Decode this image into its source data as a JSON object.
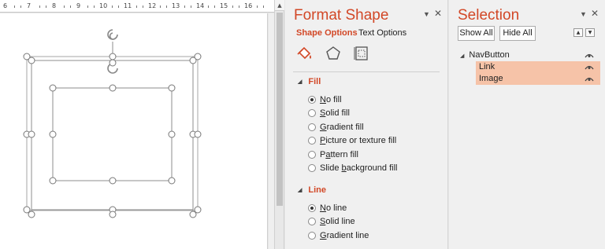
{
  "ruler": {
    "labels": [
      "6",
      "7",
      "8",
      "9",
      "10",
      "11",
      "12",
      "13",
      "14",
      "15",
      "16"
    ]
  },
  "format_shape": {
    "title": "Format Shape",
    "tabs": [
      {
        "label": "Shape Options",
        "active": true
      },
      {
        "label": "Text Options",
        "active": false
      }
    ],
    "icons": [
      "fill-line-icon",
      "effects-pentagon-icon",
      "size-properties-icon"
    ],
    "fill": {
      "header": "Fill",
      "options": [
        {
          "label": "No fill",
          "checked": true
        },
        {
          "label": "Solid fill",
          "checked": false
        },
        {
          "label": "Gradient fill",
          "checked": false
        },
        {
          "label": "Picture or texture fill",
          "checked": false
        },
        {
          "label": "Pattern fill",
          "checked": false
        },
        {
          "label": "Slide background fill",
          "checked": false
        }
      ]
    },
    "line": {
      "header": "Line",
      "options": [
        {
          "label": "No line",
          "checked": true
        },
        {
          "label": "Solid line",
          "checked": false
        },
        {
          "label": "Gradient line",
          "checked": false
        }
      ]
    }
  },
  "selection": {
    "title": "Selection",
    "show_all": "Show All",
    "hide_all": "Hide All",
    "tree": [
      {
        "label": "NavButton",
        "selected": false
      },
      {
        "label": "Link",
        "selected": true
      },
      {
        "label": "Image",
        "selected": true
      }
    ]
  },
  "colors": {
    "accent": "#d24726",
    "selected_row": "#f6c3a8",
    "pane_bg": "#f0f0f0"
  }
}
